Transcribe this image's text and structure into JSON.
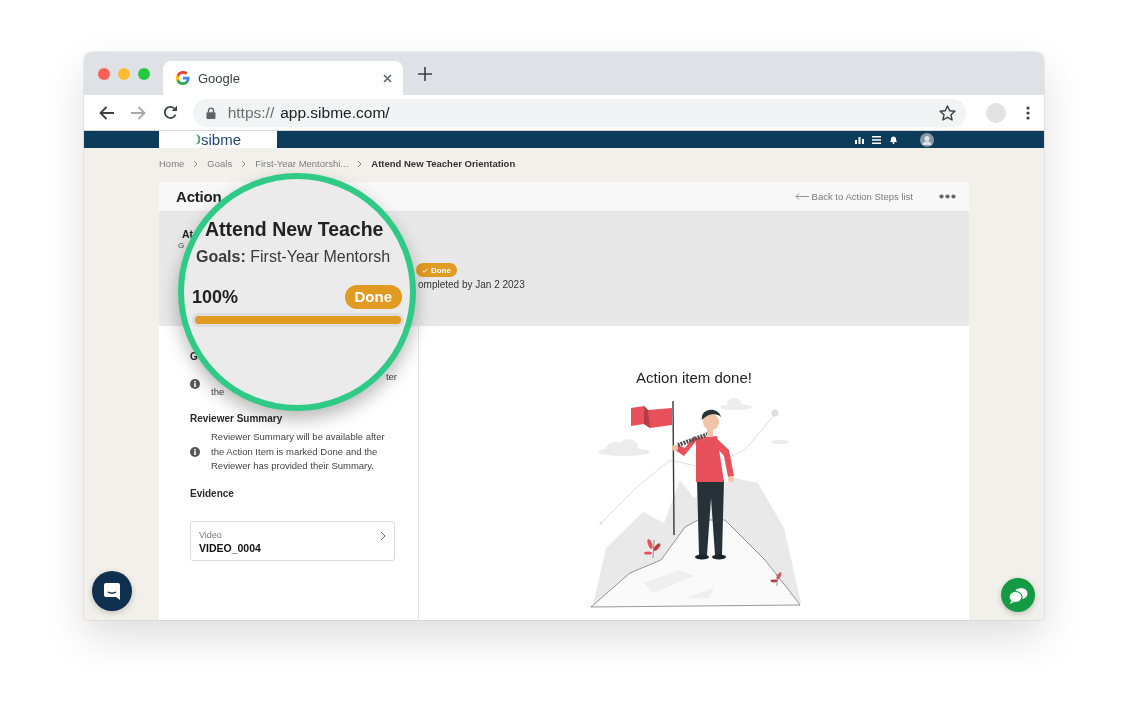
{
  "browser": {
    "tab_title": "Google",
    "url_scheme": "https://",
    "url_host": "app.sibme.com/"
  },
  "app_header": {
    "logo": "sibme"
  },
  "breadcrumb": [
    {
      "label": "Home",
      "current": false
    },
    {
      "label": "Goals",
      "current": false
    },
    {
      "label": "First-Year Mentorshi...",
      "current": false
    },
    {
      "label": "Attend New Teacher Orientation",
      "current": true
    }
  ],
  "card": {
    "title": "Action",
    "back_link": "Back to Action Steps list"
  },
  "summary": {
    "title": "At",
    "goals": "G",
    "status": "Done",
    "completed": "ompleted by Jan 2 2023"
  },
  "magnifier": {
    "title": "Attend New Teache",
    "goals": "**Goals:** First-Year Mentorsh",
    "percent": "100%",
    "status": "Done",
    "level": 1
  },
  "sections": [
    {
      "kind": "partial",
      "heading": "G",
      "lines": [
        "ter",
        "the"
      ]
    },
    {
      "kind": "info",
      "heading": "Reviewer Summary",
      "text": "Reviewer Summary will be available after the Action Item is marked Done and the Reviewer has provided their Summary."
    }
  ],
  "evidence": {
    "heading": "Evidence",
    "items": [
      {
        "label": "Video",
        "name": "VIDEO_0004"
      }
    ]
  },
  "result": {
    "message": "Action item done!"
  }
}
